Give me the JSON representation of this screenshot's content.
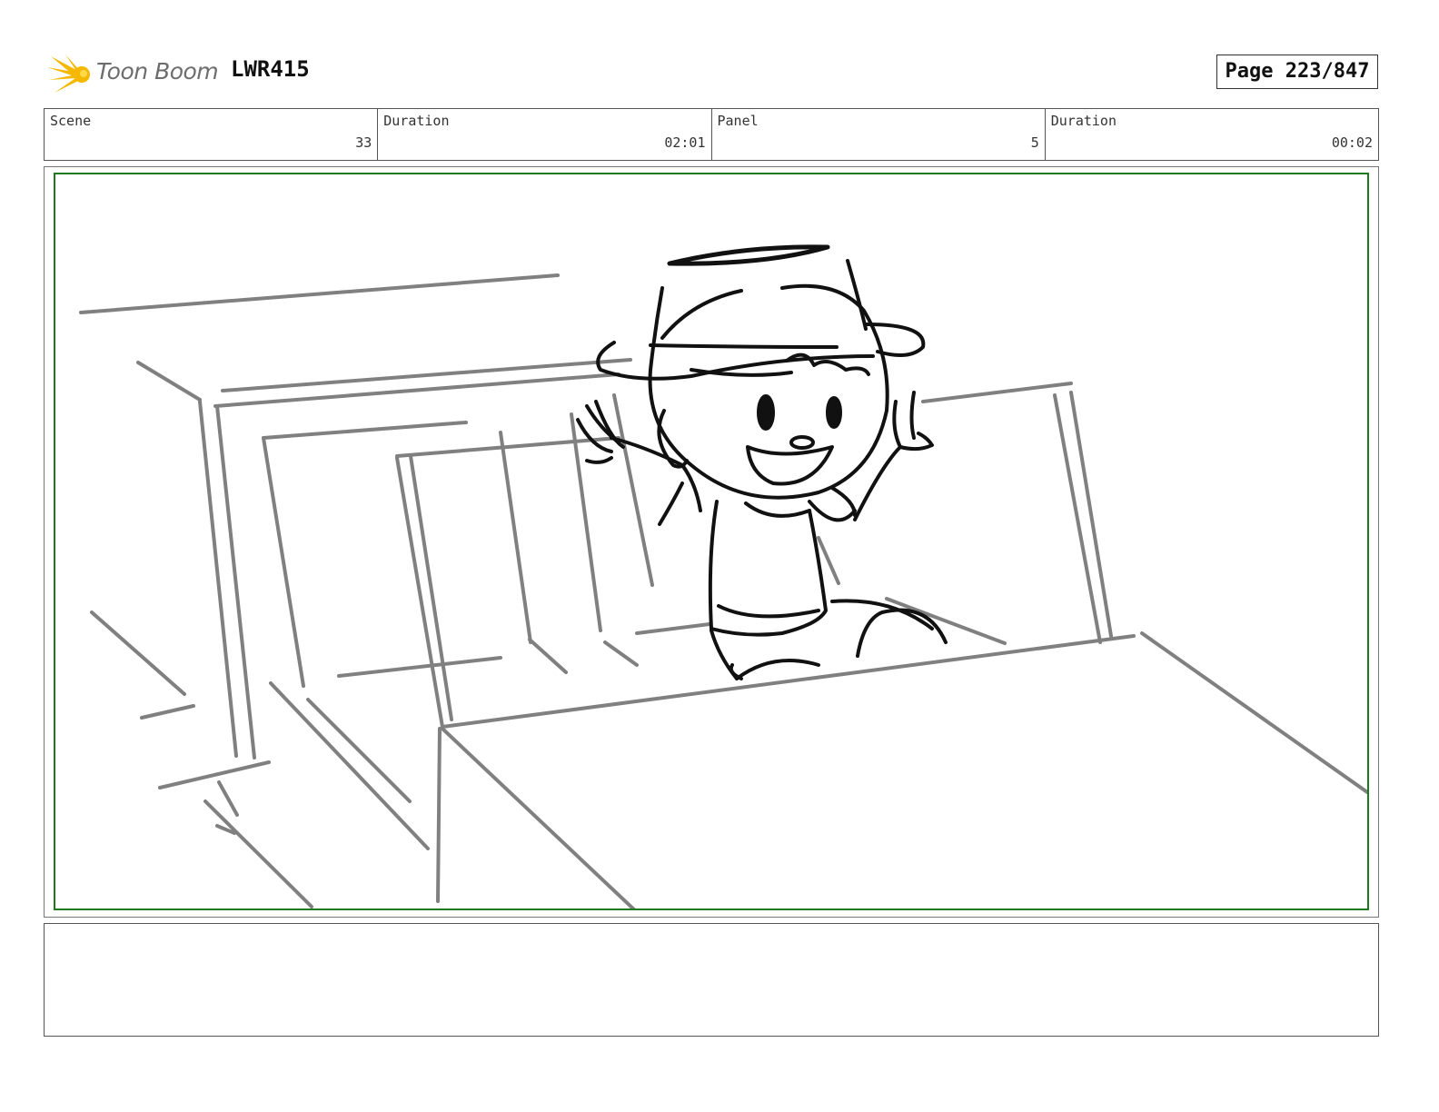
{
  "header": {
    "logo_text": "Toon Boom",
    "project_code": "LWR415",
    "page": "Page 223/847"
  },
  "info": {
    "scene_label": "Scene",
    "scene_value": "33",
    "scene_duration_label": "Duration",
    "scene_duration_value": "02:01",
    "panel_label": "Panel",
    "panel_value": "5",
    "panel_duration_label": "Duration",
    "panel_duration_value": "00:02"
  },
  "panel": {
    "frame_color": "#1f7a1f",
    "background_sketch_color": "#808080",
    "character_sketch_color": "#111111"
  },
  "notes": {
    "text": ""
  }
}
